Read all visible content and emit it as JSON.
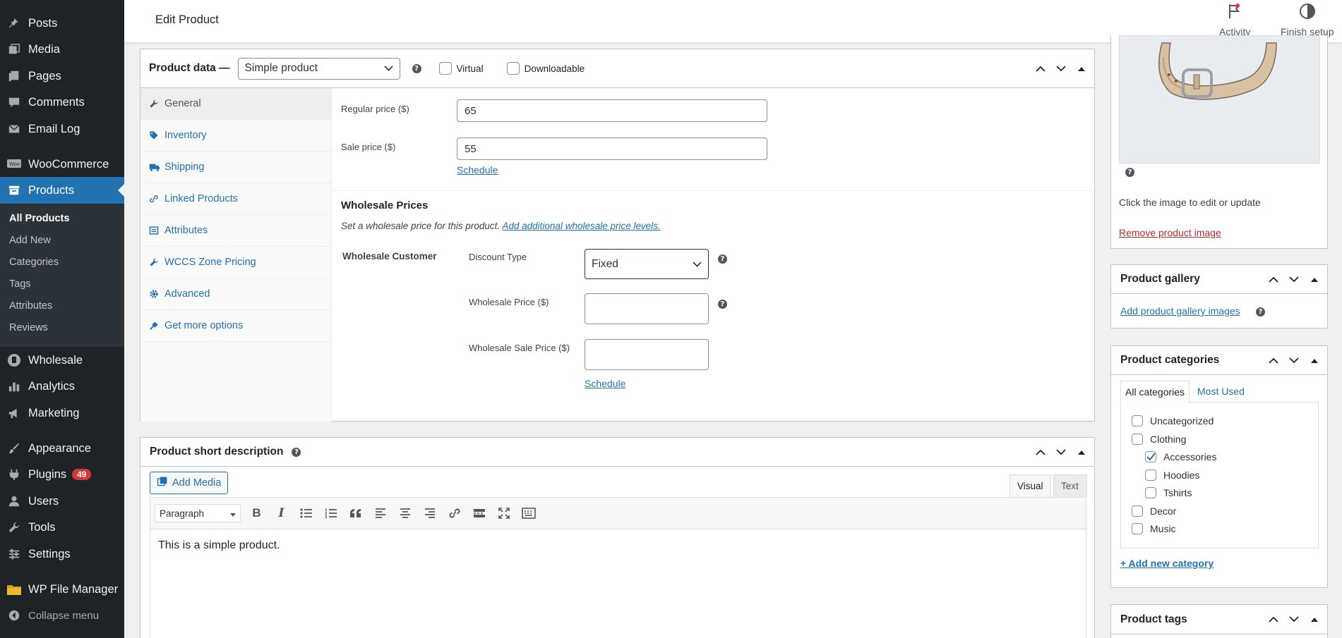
{
  "sidebar": {
    "items": [
      {
        "label": "Posts",
        "icon": "pin-icon"
      },
      {
        "label": "Media",
        "icon": "media-icon"
      },
      {
        "label": "Pages",
        "icon": "pages-icon"
      },
      {
        "label": "Comments",
        "icon": "comment-icon"
      },
      {
        "label": "Email Log",
        "icon": "email-icon"
      },
      {
        "label": "WooCommerce",
        "icon": "woocommerce-icon"
      },
      {
        "label": "Products",
        "icon": "archive-icon"
      },
      {
        "label": "Wholesale",
        "icon": "wholesale-icon"
      },
      {
        "label": "Analytics",
        "icon": "chart-bar-icon"
      },
      {
        "label": "Marketing",
        "icon": "megaphone-icon"
      },
      {
        "label": "Appearance",
        "icon": "brush-icon"
      },
      {
        "label": "Plugins",
        "icon": "plugin-icon",
        "badge": "49"
      },
      {
        "label": "Users",
        "icon": "user-icon"
      },
      {
        "label": "Tools",
        "icon": "wrench-icon"
      },
      {
        "label": "Settings",
        "icon": "settings-icon"
      },
      {
        "label": "WP File Manager",
        "icon": "folder-icon"
      }
    ],
    "submenu": [
      "All Products",
      "Add New",
      "Categories",
      "Tags",
      "Attributes",
      "Reviews"
    ],
    "collapse_label": "Collapse menu"
  },
  "topbar": {
    "title": "Edit Product",
    "activity_label": "Activity",
    "finish_setup_label": "Finish setup"
  },
  "product_data": {
    "title": "Product data —",
    "product_type": "Simple product",
    "virtual_label": "Virtual",
    "downloadable_label": "Downloadable",
    "tabs": [
      "General",
      "Inventory",
      "Shipping",
      "Linked Products",
      "Attributes",
      "WCCS Zone Pricing",
      "Advanced",
      "Get more options"
    ],
    "regular_price_label": "Regular price ($)",
    "regular_price_value": "65",
    "sale_price_label": "Sale price ($)",
    "sale_price_value": "55",
    "schedule_label": "Schedule",
    "wholesale": {
      "heading": "Wholesale Prices",
      "description": "Set a wholesale price for this product.",
      "link": "Add additional wholesale price levels.",
      "role": "Wholesale Customer",
      "discount_type_label": "Discount Type",
      "discount_type_value": "Fixed",
      "price_label": "Wholesale Price ($)",
      "price_value": "",
      "sale_price_label": "Wholesale Sale Price ($)",
      "sale_price_value": "",
      "schedule_label": "Schedule"
    }
  },
  "short_description": {
    "title": "Product short description",
    "add_media_label": "Add Media",
    "visual_tab": "Visual",
    "text_tab": "Text",
    "format_select": "Paragraph",
    "content": "This is a simple product."
  },
  "product_image": {
    "hint": "Click the image to edit or update",
    "remove_link": "Remove product image"
  },
  "gallery": {
    "title": "Product gallery",
    "add_link": "Add product gallery images"
  },
  "categories": {
    "title": "Product categories",
    "tab_all": "All categories",
    "tab_most_used": "Most Used",
    "items": [
      {
        "label": "Uncategorized",
        "checked": false,
        "child": false
      },
      {
        "label": "Clothing",
        "checked": false,
        "child": false
      },
      {
        "label": "Accessories",
        "checked": true,
        "child": true
      },
      {
        "label": "Hoodies",
        "checked": false,
        "child": true
      },
      {
        "label": "Tshirts",
        "checked": false,
        "child": true
      },
      {
        "label": "Decor",
        "checked": false,
        "child": false
      },
      {
        "label": "Music",
        "checked": false,
        "child": false
      }
    ],
    "add_new_link": "+ Add new category"
  },
  "tags": {
    "title": "Product tags"
  },
  "colors": {
    "sidebar_bg": "#1d2327",
    "accent": "#2271b1",
    "danger": "#d63638"
  }
}
